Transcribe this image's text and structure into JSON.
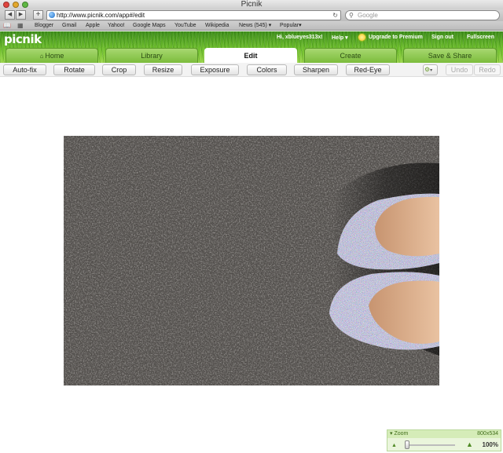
{
  "window": {
    "title": "Picnik",
    "url": "http://www.picnik.com/app#/edit",
    "search_placeholder": "Google",
    "reload_icon": "reload-icon"
  },
  "bookmarks": [
    "Blogger",
    "Gmail",
    "Apple",
    "Yahoo!",
    "Google Maps",
    "YouTube",
    "Wikipedia",
    "News (545)",
    "Popular"
  ],
  "header": {
    "logo": "picnik",
    "greeting": "Hi, xblueyes313x!",
    "help": "Help",
    "upgrade": "Upgrade to Premium",
    "signout": "Sign out",
    "fullscreen": "Fullscreen"
  },
  "tabs": [
    {
      "label": "Home",
      "active": false
    },
    {
      "label": "Library",
      "active": false
    },
    {
      "label": "Edit",
      "active": true
    },
    {
      "label": "Create",
      "active": false
    },
    {
      "label": "Save & Share",
      "active": false
    }
  ],
  "tools": [
    "Auto-fix",
    "Rotate",
    "Crop",
    "Resize",
    "Exposure",
    "Colors",
    "Sharpen",
    "Red-Eye"
  ],
  "history": {
    "undo": "Undo",
    "redo": "Redo"
  },
  "zoom": {
    "label": "Zoom",
    "dimensions": "800x534",
    "percent": "100%",
    "level": 0.05
  },
  "colors": {
    "accent_green": "#6fbf2d",
    "asphalt": "#4a4744",
    "skin": "#e0b490"
  }
}
